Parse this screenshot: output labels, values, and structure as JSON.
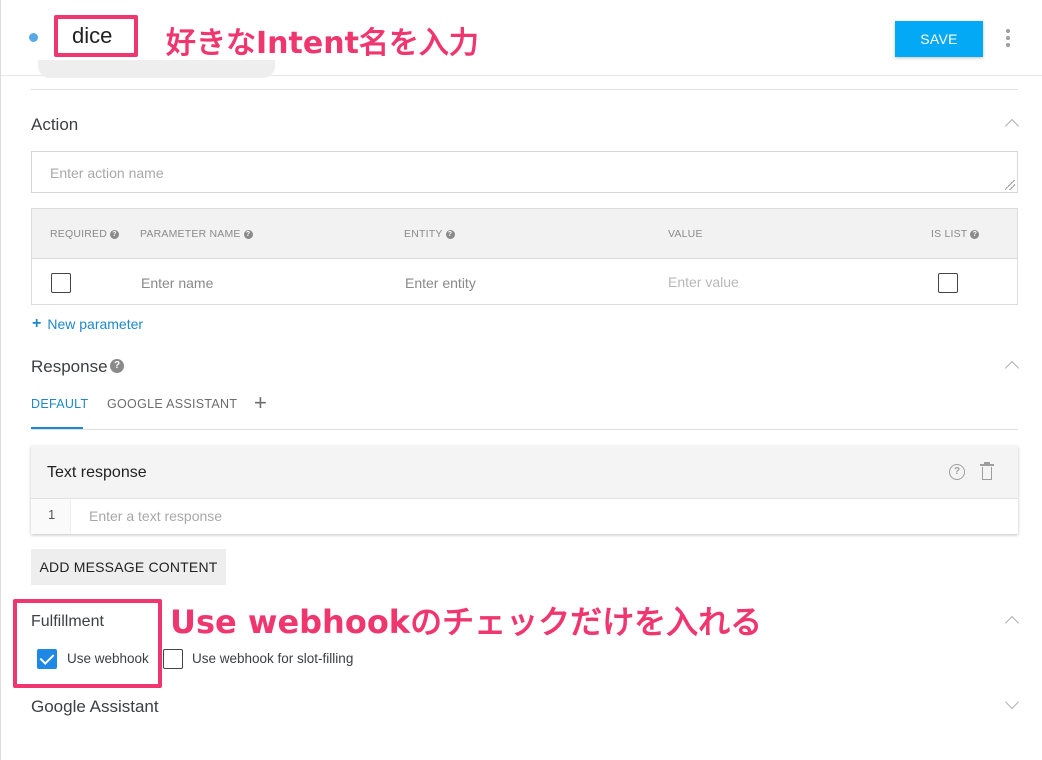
{
  "intent": {
    "name": "dice",
    "save_label": "SAVE",
    "annotation": "好きなIntent名を入力"
  },
  "action": {
    "title": "Action",
    "placeholder": "Enter action name",
    "columns": [
      "REQUIRED",
      "PARAMETER NAME",
      "ENTITY",
      "VALUE",
      "IS LIST"
    ],
    "row": {
      "name_placeholder": "Enter name",
      "entity_placeholder": "Enter entity",
      "value_placeholder": "Enter value"
    },
    "new_parameter": "New parameter"
  },
  "response": {
    "title": "Response",
    "tabs": [
      "DEFAULT",
      "GOOGLE ASSISTANT"
    ],
    "card_title": "Text response",
    "row_number": "1",
    "text_placeholder": "Enter a text response",
    "add_button": "ADD MESSAGE CONTENT"
  },
  "fulfillment": {
    "title": "Fulfillment",
    "options": [
      "Use webhook",
      "Use webhook for slot-filling"
    ],
    "annotation": "Use webhookのチェックだけを入れる"
  },
  "google_assistant": {
    "title": "Google Assistant"
  },
  "colors": {
    "accent": "#1e88c9",
    "save_button": "#03a9f4",
    "annotation": "#f0366f",
    "checkbox_checked": "#1e88e5"
  },
  "icons": [
    "more-vert-icon",
    "chevron-up-icon",
    "chevron-down-icon",
    "help-icon",
    "trash-icon",
    "plus-icon",
    "check-icon"
  ]
}
